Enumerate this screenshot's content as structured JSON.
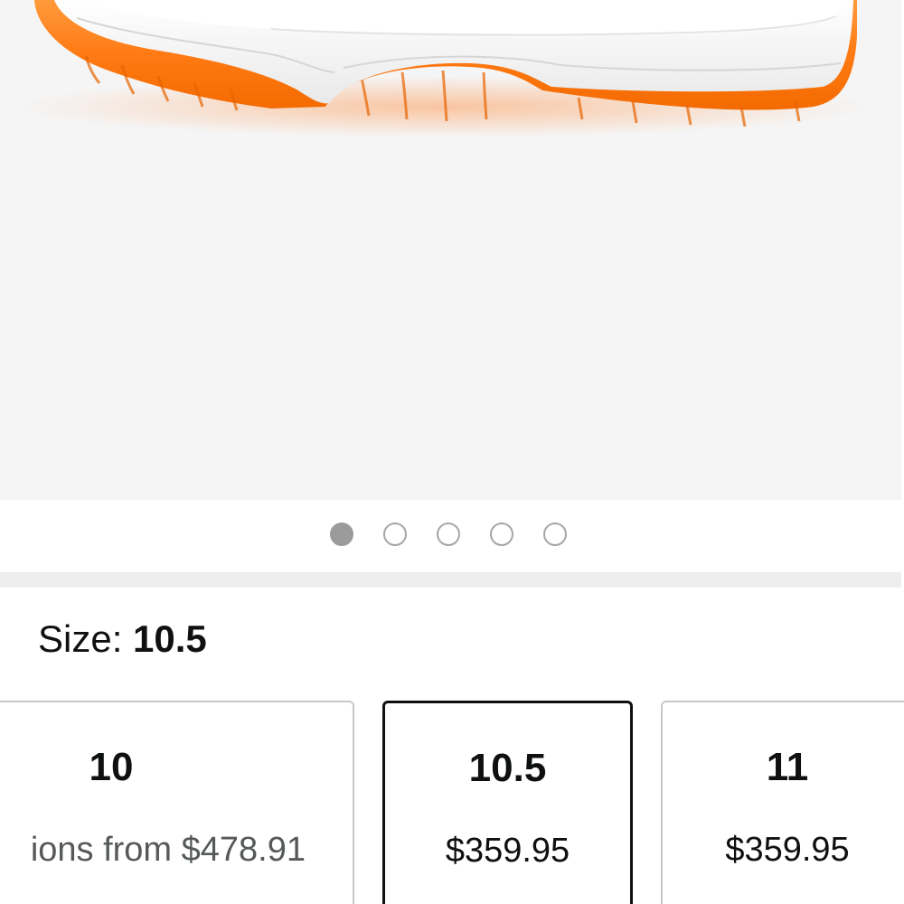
{
  "gallery": {
    "image_alt": "White sneaker with orange translucent outsole",
    "pager": {
      "count": 5,
      "active_index": 0
    },
    "colors": {
      "background": "#f5f5f5",
      "upper": "#ffffff",
      "sole": "#ff7a14"
    }
  },
  "size_selector": {
    "label_prefix": "Size: ",
    "selected_value": "10.5",
    "options": [
      {
        "size": "10",
        "price": "ions from $478.91",
        "selected": false
      },
      {
        "size": "10.5",
        "price": "$359.95",
        "selected": true
      },
      {
        "size": "11",
        "price": "$359.95",
        "selected": false
      }
    ]
  }
}
